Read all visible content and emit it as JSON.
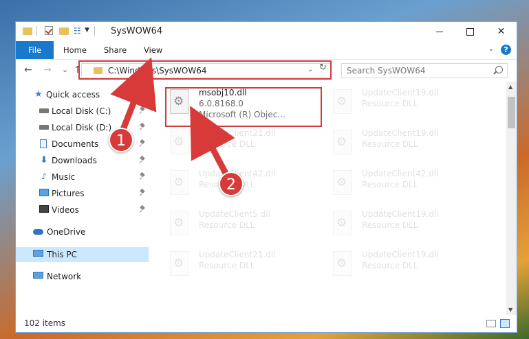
{
  "window": {
    "title": "SysWOW64",
    "controls": {
      "minimize": "minimize",
      "maximize": "maximize",
      "close": "✕"
    }
  },
  "ribbon": {
    "file": "File",
    "tabs": [
      "Home",
      "Share",
      "View"
    ]
  },
  "nav": {
    "back": "←",
    "forward": "→",
    "recent": "⌄",
    "up": "↑",
    "address": "C:\\Windows\\SysWOW64",
    "refresh": "↻",
    "search_placeholder": "Search SysWOW64"
  },
  "sidebar": {
    "items": [
      {
        "label": "Quick access",
        "icon": "star-icon",
        "pinned": false
      },
      {
        "label": "Local Disk (C:)",
        "icon": "disk-icon",
        "pinned": true
      },
      {
        "label": "Local Disk (D:)",
        "icon": "disk-icon",
        "pinned": true
      },
      {
        "label": "Documents",
        "icon": "documents-icon",
        "pinned": true
      },
      {
        "label": "Downloads",
        "icon": "download-icon",
        "pinned": true
      },
      {
        "label": "Music",
        "icon": "music-icon",
        "pinned": true
      },
      {
        "label": "Pictures",
        "icon": "pictures-icon",
        "pinned": true
      },
      {
        "label": "Videos",
        "icon": "videos-icon",
        "pinned": true
      },
      {
        "label": "OneDrive",
        "icon": "cloud-icon",
        "pinned": false
      },
      {
        "label": "This PC",
        "icon": "computer-icon",
        "pinned": false,
        "selected": true
      },
      {
        "label": "Network",
        "icon": "network-icon",
        "pinned": false
      }
    ]
  },
  "files": {
    "selected": {
      "name": "msobj10.dll",
      "version": "6.0.8168.0",
      "description": "Microsoft (R) Objec..."
    },
    "faded": [
      {
        "name": "UpdateClient19.dll",
        "type": "Resource DLL"
      },
      {
        "name": "UpdateClient21.dll",
        "type": "Resource DLL"
      },
      {
        "name": "UpdateClient19.dll",
        "type": "Resource DLL"
      },
      {
        "name": "UpdateClient42.dll",
        "type": "Resource DLL"
      },
      {
        "name": "UpdateClient42.dll",
        "type": "Resource DLL"
      },
      {
        "name": "UpdateClient5.dll",
        "type": "Resource DLL"
      },
      {
        "name": "UpdateClient19.dll",
        "type": "Resource DLL"
      },
      {
        "name": "UpdateClient21.dll",
        "type": "Resource DLL"
      },
      {
        "name": "UpdateClient19.dll",
        "type": "Resource DLL"
      }
    ]
  },
  "status": {
    "items": "102 items"
  },
  "annotations": {
    "step1": "1",
    "step2": "2"
  },
  "colors": {
    "accent": "#1979ca",
    "highlight": "#d23a3a",
    "selection": "#cce8ff"
  }
}
